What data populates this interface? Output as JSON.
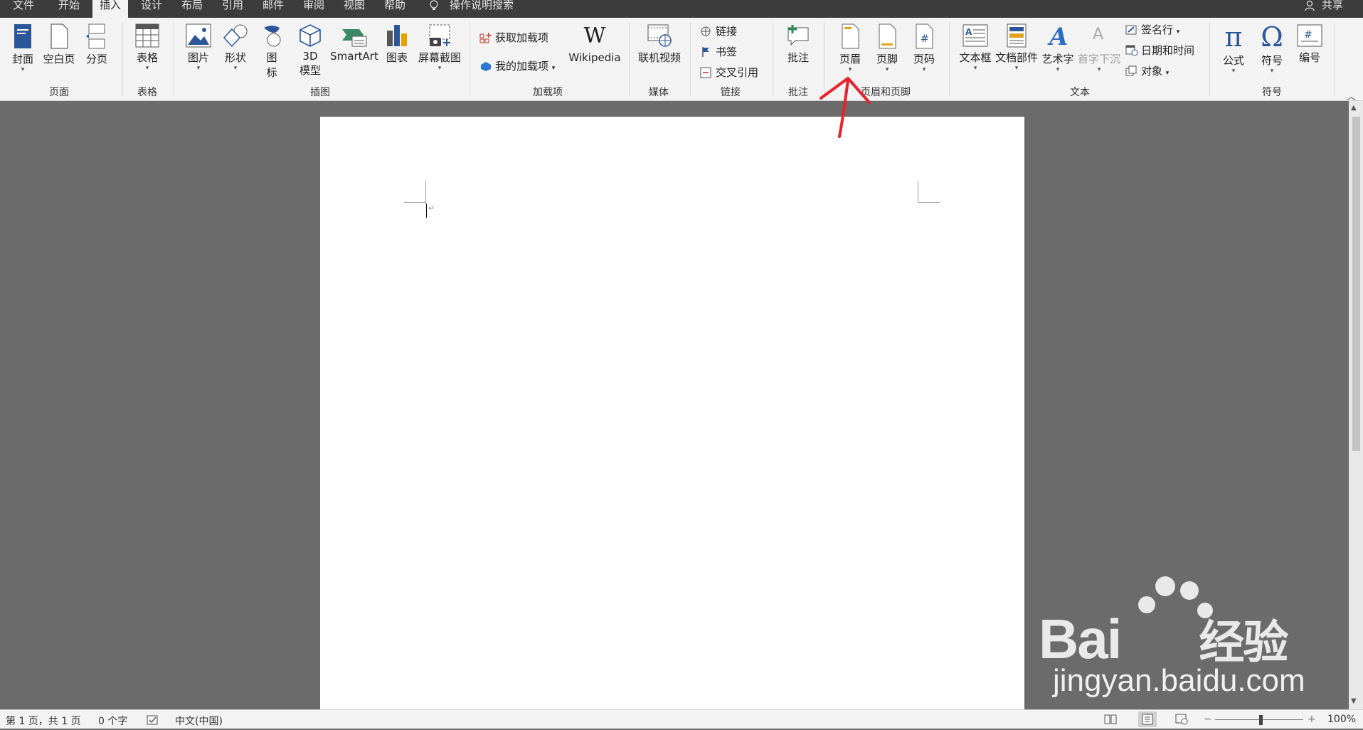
{
  "tabs": [
    "文件",
    "开始",
    "插入",
    "设计",
    "布局",
    "引用",
    "邮件",
    "审阅",
    "视图",
    "帮助"
  ],
  "active_tab": "插入",
  "tell_me": "操作说明搜索",
  "share": "共享",
  "groups": {
    "pages": {
      "label": "页面",
      "cover": "封面",
      "blank": "空白页",
      "break": "分页"
    },
    "tables": {
      "label": "表格",
      "table": "表格"
    },
    "illustrations": {
      "label": "插图",
      "picture": "图片",
      "shapes": "形状",
      "icons_1": "图",
      "icons_2": "标",
      "model_1": "3D",
      "model_2": "模型",
      "smartart": "SmartArt",
      "chart": "图表",
      "screenshot": "屏幕截图"
    },
    "addins": {
      "label": "加载项",
      "get": "获取加载项",
      "mine": "我的加载项",
      "wikipedia": "Wikipedia"
    },
    "media": {
      "label": "媒体",
      "video": "联机视频"
    },
    "links": {
      "label": "链接",
      "link": "链接",
      "bookmark": "书签",
      "crossref": "交叉引用"
    },
    "comments": {
      "label": "批注",
      "comment": "批注"
    },
    "header_footer": {
      "label": "页眉和页脚",
      "header": "页眉",
      "footer": "页脚",
      "page_number": "页码"
    },
    "text": {
      "label": "文本",
      "textbox": "文本框",
      "quickparts": "文档部件",
      "wordart": "艺术字",
      "dropcap": "首字下沉",
      "signature": "签名行",
      "datetime": "日期和时间",
      "object": "对象"
    },
    "symbols": {
      "label": "符号",
      "equation": "公式",
      "symbol": "符号",
      "number": "编号"
    }
  },
  "icons": {
    "pi": "π",
    "omega": "Ω",
    "wiki": "W",
    "hash": "#"
  },
  "status": {
    "page": "第 1 页，共 1 页",
    "words": "0 个字",
    "language": "中文(中国)",
    "zoom": "100%",
    "minus": "−",
    "plus": "+"
  },
  "watermark": {
    "brand": "Bai",
    "suffix": "经验",
    "url": "jingyan.baidu.com"
  },
  "colors": {
    "annotation_arrow": "#e8212a",
    "ribbon_blue": "#2b579a"
  }
}
